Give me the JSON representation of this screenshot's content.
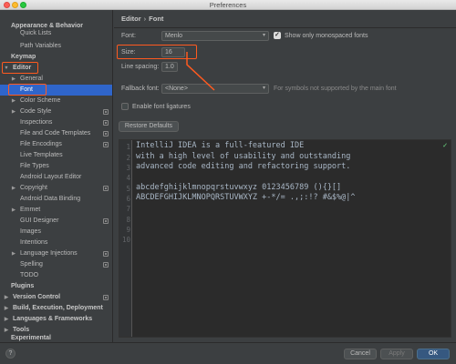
{
  "window": {
    "title": "Preferences"
  },
  "sidebar": {
    "items": [
      {
        "label": "Appearance & Behavior",
        "bold": true
      },
      {
        "label": "Quick Lists"
      },
      {
        "label": "Path Variables"
      },
      {
        "label": "Keymap",
        "bold": true
      },
      {
        "label": "Editor",
        "bold": true
      },
      {
        "label": "General"
      },
      {
        "label": "Font"
      },
      {
        "label": "Color Scheme"
      },
      {
        "label": "Code Style"
      },
      {
        "label": "Inspections"
      },
      {
        "label": "File and Code Templates"
      },
      {
        "label": "File Encodings"
      },
      {
        "label": "Live Templates"
      },
      {
        "label": "File Types"
      },
      {
        "label": "Android Layout Editor"
      },
      {
        "label": "Copyright"
      },
      {
        "label": "Android Data Binding"
      },
      {
        "label": "Emmet"
      },
      {
        "label": "GUI Designer"
      },
      {
        "label": "Images"
      },
      {
        "label": "Intentions"
      },
      {
        "label": "Language Injections"
      },
      {
        "label": "Spelling"
      },
      {
        "label": "TODO"
      },
      {
        "label": "Plugins",
        "bold": true
      },
      {
        "label": "Version Control",
        "bold": true
      },
      {
        "label": "Build, Execution, Deployment",
        "bold": true
      },
      {
        "label": "Languages & Frameworks",
        "bold": true
      },
      {
        "label": "Tools",
        "bold": true
      },
      {
        "label": "Experimental",
        "bold": true
      }
    ]
  },
  "breadcrumb": {
    "section": "Editor",
    "page": "Font"
  },
  "font_settings": {
    "font_label": "Font:",
    "font_value": "Menlo",
    "monospaced_label": "Show only monospaced fonts",
    "monospaced_checked": true,
    "size_label": "Size:",
    "size_value": "16",
    "line_spacing_label": "Line spacing:",
    "line_spacing_value": "1.0",
    "fallback_label": "Fallback font:",
    "fallback_value": "<None>",
    "fallback_hint": "For symbols not supported by the main font",
    "ligatures_label": "Enable font ligatures",
    "ligatures_checked": false,
    "restore_defaults_label": "Restore Defaults"
  },
  "preview": {
    "line_numbers": [
      "1",
      "2",
      "3",
      "4",
      "5",
      "6",
      "7",
      "8",
      "9",
      "10"
    ],
    "lines": [
      "IntelliJ IDEA is a full-featured IDE",
      "with a high level of usability and outstanding",
      "advanced code editing and refactoring support.",
      "",
      "abcdefghijklmnopqrstuvwxyz 0123456789 (){}[]",
      "ABCDEFGHIJKLMNOPQRSTUVWXYZ +-*/= .,;:!? #&$%@|^"
    ]
  },
  "footer": {
    "help_label": "?",
    "cancel_label": "Cancel",
    "apply_label": "Apply",
    "ok_label": "OK"
  },
  "colors": {
    "accent": "#2f65ca",
    "highlight": "#ff5a1f",
    "background": "#3c3f41",
    "editor_bg": "#2b2b2b"
  }
}
